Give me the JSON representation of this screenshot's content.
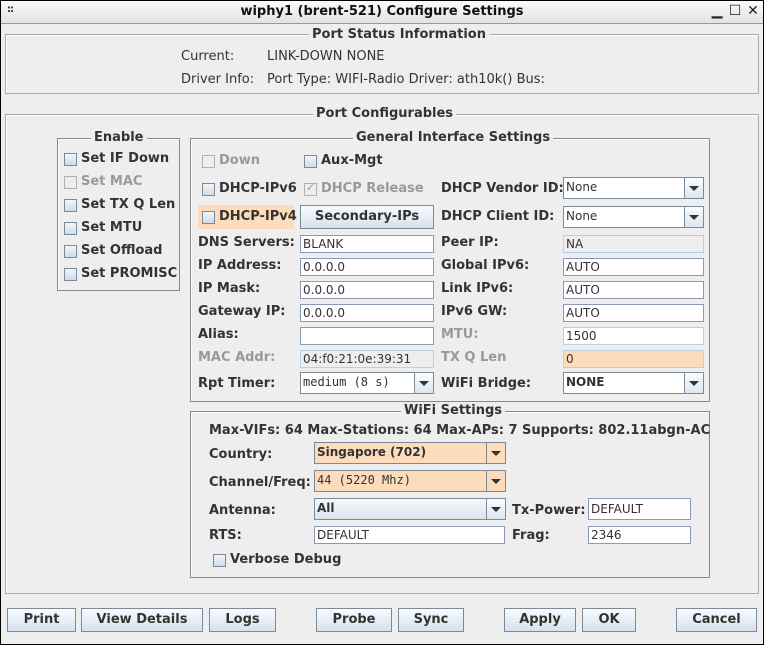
{
  "window": {
    "title": "wiphy1  (brent-521) Configure Settings",
    "controls": {
      "grip": "::",
      "minimize": "▁",
      "maximize": "☐",
      "close": "✕"
    }
  },
  "status": {
    "legend": "Port Status Information",
    "current_label": "Current:",
    "current_value": "LINK-DOWN  NONE",
    "driver_label": "Driver Info:",
    "driver_value": "Port Type: WIFI-Radio   Driver: ath10k()  Bus:"
  },
  "configurables": {
    "legend": "Port Configurables",
    "enable": {
      "legend": "Enable",
      "items": [
        {
          "label": "Set IF Down",
          "checked": false,
          "disabled": false
        },
        {
          "label": "Set MAC",
          "checked": false,
          "disabled": true
        },
        {
          "label": "Set TX Q Len",
          "checked": false,
          "disabled": false
        },
        {
          "label": "Set MTU",
          "checked": false,
          "disabled": false
        },
        {
          "label": "Set Offload",
          "checked": false,
          "disabled": false
        },
        {
          "label": "Set PROMISC",
          "checked": false,
          "disabled": false
        }
      ]
    },
    "general": {
      "legend": "General Interface Settings",
      "down": "Down",
      "aux_mgt": "Aux-Mgt",
      "dhcp_ipv6": "DHCP-IPv6",
      "dhcp_release": "DHCP Release",
      "dhcp_ipv4": "DHCP-IPv4",
      "secondary_ips": "Secondary-IPs",
      "dhcp_vendor_id_label": "DHCP Vendor ID:",
      "dhcp_vendor_id": "None",
      "dhcp_client_id_label": "DHCP Client ID:",
      "dhcp_client_id": "None",
      "dns_label": "DNS Servers:",
      "dns": "BLANK",
      "peer_ip_label": "Peer IP:",
      "peer_ip": "NA",
      "ip_label": "IP Address:",
      "ip": "0.0.0.0",
      "global_ipv6_label": "Global IPv6:",
      "global_ipv6": "AUTO",
      "mask_label": "IP Mask:",
      "mask": "0.0.0.0",
      "link_ipv6_label": "Link IPv6:",
      "link_ipv6": "AUTO",
      "gw_label": "Gateway IP:",
      "gw": "0.0.0.0",
      "ipv6_gw_label": "IPv6 GW:",
      "ipv6_gw": "AUTO",
      "alias_label": "Alias:",
      "alias": "",
      "mtu_label": "MTU:",
      "mtu": "1500",
      "mac_label": "MAC Addr:",
      "mac": "04:f0:21:0e:39:31",
      "txq_label": "TX Q Len",
      "txq": "0",
      "rpt_label": "Rpt Timer:",
      "rpt": "medium  (8 s)",
      "bridge_label": "WiFi Bridge:",
      "bridge": "NONE"
    },
    "wifi": {
      "legend": "WiFi Settings",
      "caps": "Max-VIFs: 64  Max-Stations: 64  Max-APs: 7  Supports: 802.11abgn-AC",
      "country_label": "Country:",
      "country": "Singapore (702)",
      "channel_label": "Channel/Freq:",
      "channel": " 44 (5220 Mhz)",
      "antenna_label": "Antenna:",
      "antenna": "All",
      "txpower_label": "Tx-Power:",
      "txpower": "DEFAULT",
      "rts_label": "RTS:",
      "rts": "DEFAULT",
      "frag_label": "Frag:",
      "frag": "2346",
      "verbose": "Verbose Debug"
    }
  },
  "buttons": {
    "print": "Print",
    "view_details": "View Details",
    "logs": "Logs",
    "probe": "Probe",
    "sync": "Sync",
    "apply": "Apply",
    "ok": "OK",
    "cancel": "Cancel"
  }
}
